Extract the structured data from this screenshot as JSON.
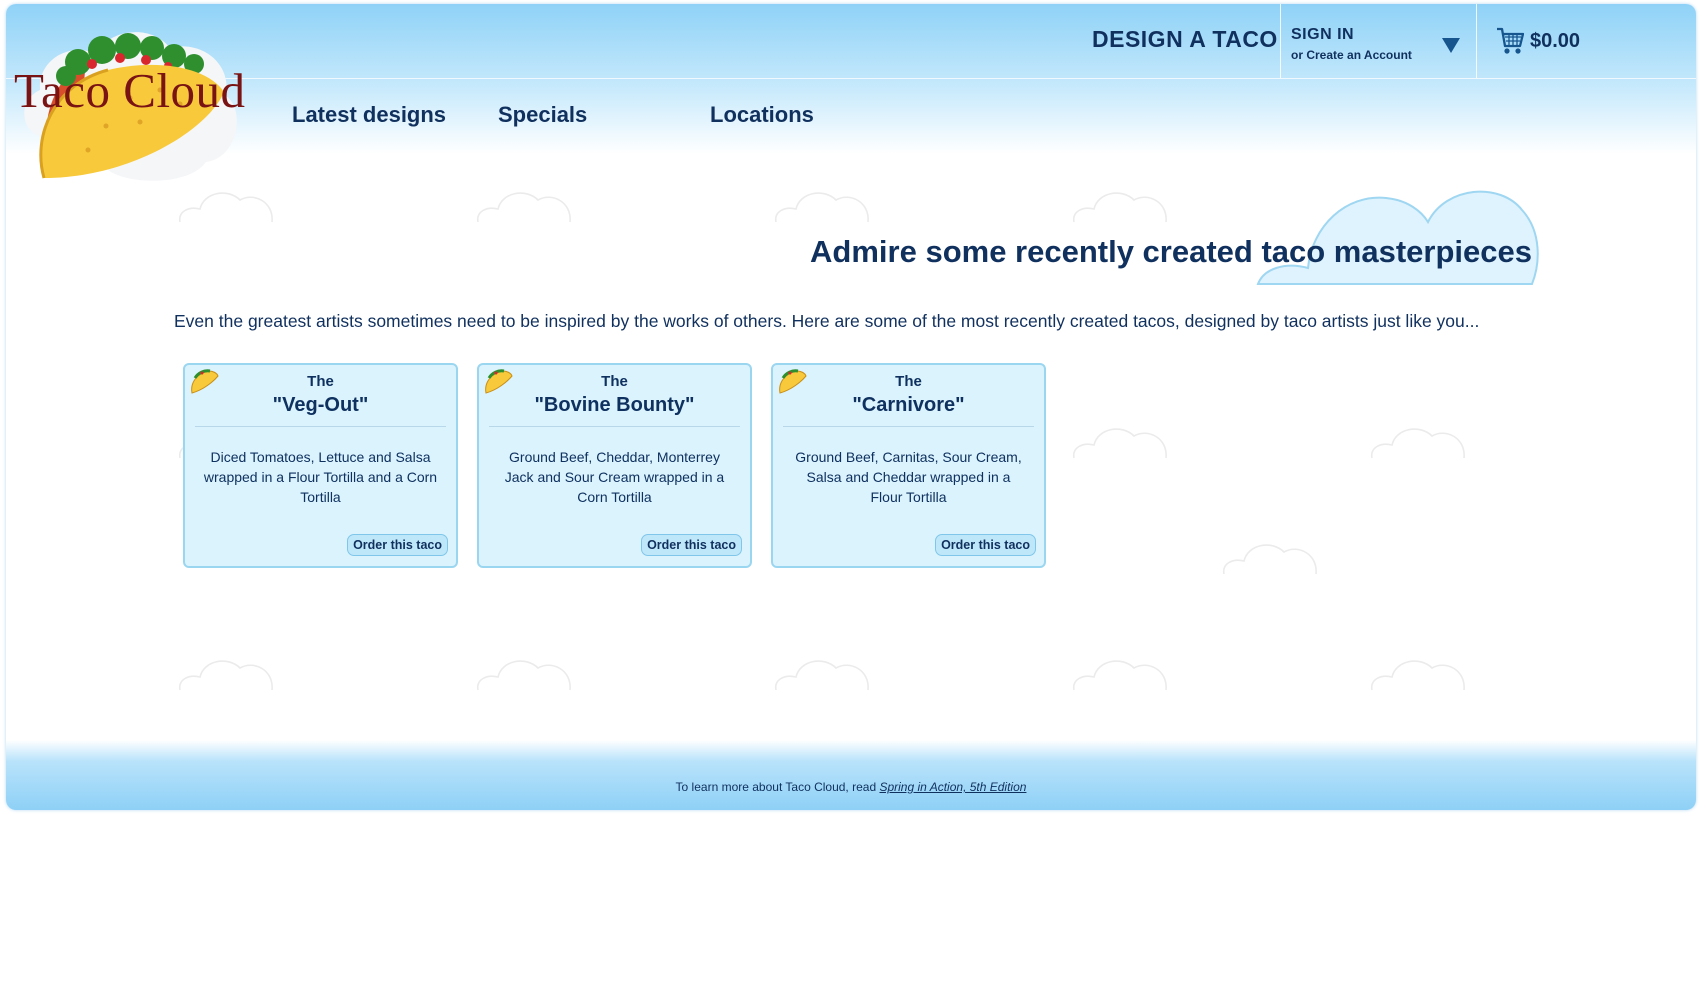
{
  "header": {
    "logo_text": "Taco Cloud",
    "design_link": "DESIGN A TACO",
    "signin": {
      "main": "SIGN IN",
      "sub": "or Create an Account"
    },
    "cart_total": "$0.00"
  },
  "nav": [
    {
      "label": "Latest designs"
    },
    {
      "label": "Specials"
    },
    {
      "label": "Locations"
    }
  ],
  "main": {
    "title": "Admire some recently created taco masterpieces",
    "intro": "Even the greatest artists sometimes need to be inspired by the works of others. Here are some of the most recently created tacos, designed by taco artists just like you...",
    "cards": [
      {
        "prefix": "The",
        "name": "\"Veg-Out\"",
        "desc": "Diced Tomatoes, Lettuce and Salsa wrapped in a Flour Tortilla and a Corn Tortilla",
        "button": "Order this taco"
      },
      {
        "prefix": "The",
        "name": "\"Bovine Bounty\"",
        "desc": "Ground Beef, Cheddar, Monterrey Jack and Sour Cream wrapped in a Corn Tortilla",
        "button": "Order this taco"
      },
      {
        "prefix": "The",
        "name": "\"Carnivore\"",
        "desc": "Ground Beef, Carnitas, Sour Cream, Salsa and Cheddar wrapped in a Flour Tortilla",
        "button": "Order this taco"
      }
    ]
  },
  "footer": {
    "text": "To learn more about Taco Cloud, read",
    "link": "Spring in Action, 5th Edition"
  },
  "colors": {
    "navy": "#10305e",
    "sky": "#8fd2f7",
    "card_bg": "#dbf3fd",
    "card_border": "#9bd6f1"
  },
  "icons": [
    "taco-cloud-logo",
    "dropdown-arrow-icon",
    "shopping-cart-icon",
    "taco-icon",
    "cloud-icon"
  ]
}
